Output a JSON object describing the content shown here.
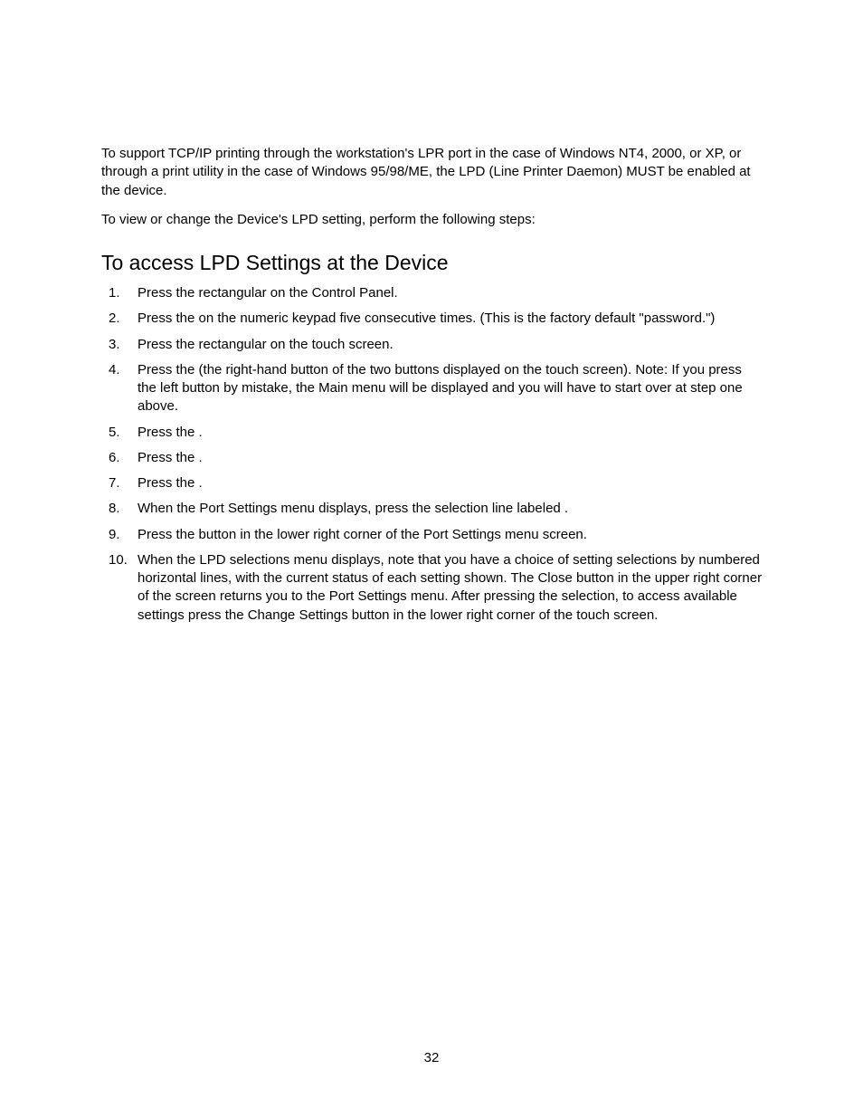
{
  "intro": {
    "p1": "To support TCP/IP printing through the workstation's LPR port in the case of Windows NT4, 2000, or XP, or through a print utility in the case of Windows 95/98/ME, the LPD (Line Printer Daemon) MUST be enabled at the device.",
    "p2": "To view or change the Device's LPD setting, perform the following steps:"
  },
  "heading": "To access LPD Settings at the Device",
  "steps": [
    "Press the rectangular                                     on the Control Panel.",
    "Press the               on the numeric keypad five consecutive times.  (This is the factory default \"password.\")",
    "Press the rectangular                                  on the touch screen.",
    "Press the                                           (the right-hand button of the two buttons displayed on the touch screen).  Note:  If you press the left button by mistake, the Main menu will be displayed and you will have to start over at step one above.",
    "Press the                                            .",
    "Press the                                             .",
    "Press the                                    .",
    "When the Port Settings menu displays, press the selection line labeled         .",
    "Press the                                 button in the lower right corner of the Port Settings menu screen.",
    "When the LPD selections menu displays, note that you have a choice of setting selections by numbered horizontal lines, with the current status of each setting shown.  The Close button in the upper right corner of the screen returns you to the Port Settings menu.  After pressing the selection, to access available settings press the Change Settings button in the lower right corner of the touch screen."
  ],
  "pageNumber": "32"
}
